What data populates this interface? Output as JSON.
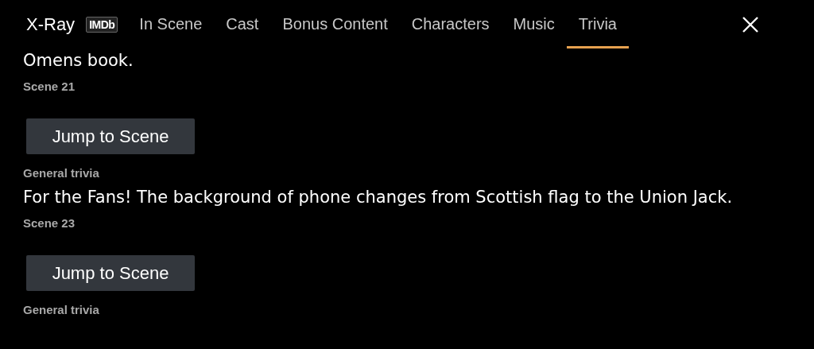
{
  "header": {
    "title": "X-Ray",
    "badge": "IMDb"
  },
  "tabs": [
    {
      "label": "In Scene",
      "selected": false
    },
    {
      "label": "Cast",
      "selected": false
    },
    {
      "label": "Bonus Content",
      "selected": false
    },
    {
      "label": "Characters",
      "selected": false
    },
    {
      "label": "Music",
      "selected": false
    },
    {
      "label": "Trivia",
      "selected": true
    }
  ],
  "trivia": [
    {
      "text": "Omens book.",
      "scene": "Scene 21",
      "button": "Jump to Scene"
    },
    {
      "category": "General trivia",
      "text": "For the Fans! The background of phone changes from Scottish flag to the Union Jack.",
      "scene": "Scene 23",
      "button": "Jump to Scene"
    },
    {
      "category": "General trivia"
    }
  ]
}
